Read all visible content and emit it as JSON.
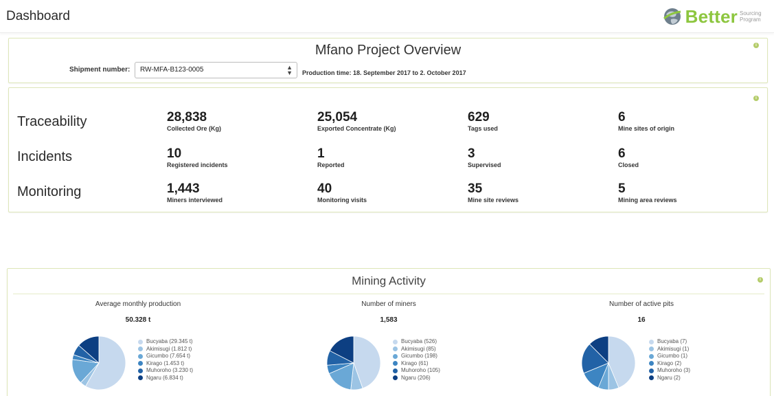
{
  "header": {
    "title": "Dashboard",
    "logo_word": "Better",
    "logo_sub": "Sourcing Program"
  },
  "overview": {
    "title": "Mfano Project Overview",
    "shipment_label": "Shipment number:",
    "shipment_value": "RW-MFA-B123-0005",
    "production_time": "Production time: 18. September 2017 to 2. October 2017"
  },
  "stats": {
    "rows": [
      {
        "label": "Traceability",
        "items": [
          {
            "value": "28,838",
            "label": "Collected Ore (Kg)"
          },
          {
            "value": "25,054",
            "label": "Exported Concentrate (Kg)"
          },
          {
            "value": "629",
            "label": "Tags used"
          },
          {
            "value": "6",
            "label": "Mine sites of origin"
          }
        ]
      },
      {
        "label": "Incidents",
        "items": [
          {
            "value": "10",
            "label": "Registered incidents"
          },
          {
            "value": "1",
            "label": "Reported"
          },
          {
            "value": "3",
            "label": "Supervised"
          },
          {
            "value": "6",
            "label": "Closed"
          }
        ]
      },
      {
        "label": "Monitoring",
        "items": [
          {
            "value": "1,443",
            "label": "Miners interviewed"
          },
          {
            "value": "40",
            "label": "Monitoring visits"
          },
          {
            "value": "35",
            "label": "Mine site reviews"
          },
          {
            "value": "5",
            "label": "Mining area reviews"
          }
        ]
      }
    ]
  },
  "mining": {
    "title": "Mining Activity",
    "palette": [
      "#c6d9ee",
      "#9cc4e4",
      "#6aa8d6",
      "#3d85c2",
      "#2262a6",
      "#0d3f82"
    ],
    "charts": [
      {
        "title": "Average monthly production",
        "total": "50.328 t",
        "legend": [
          "Bucyaba (29.345 t)",
          "Akimisugi (1.812 t)",
          "Gicumbo (7.654 t)",
          "Kirago (1.453 t)",
          "Muhoroho (3.230 t)",
          "Ngaru (6.834 t)"
        ]
      },
      {
        "title": "Number of miners",
        "total": "1,583",
        "legend": [
          "Bucyaba (526)",
          "Akimisugi (85)",
          "Gicumbo (198)",
          "Kirago (61)",
          "Muhoroho (105)",
          "Ngaru (206)"
        ]
      },
      {
        "title": "Number of active pits",
        "total": "16",
        "legend": [
          "Bucyaba (7)",
          "Akimisugi (1)",
          "Gicumbo (1)",
          "Kirago (2)",
          "Muhoroho (3)",
          "Ngaru (2)"
        ]
      }
    ]
  },
  "chart_data": [
    {
      "type": "pie",
      "categories": [
        "Bucyaba",
        "Akimisugi",
        "Gicumbo",
        "Kirago",
        "Muhoroho",
        "Ngaru"
      ],
      "values": [
        29.345,
        1.812,
        7.654,
        1.453,
        3.23,
        6.834
      ]
    },
    {
      "type": "pie",
      "categories": [
        "Bucyaba",
        "Akimisugi",
        "Gicumbo",
        "Kirago",
        "Muhoroho",
        "Ngaru"
      ],
      "values": [
        526,
        85,
        198,
        61,
        105,
        206
      ]
    },
    {
      "type": "pie",
      "categories": [
        "Bucyaba",
        "Akimisugi",
        "Gicumbo",
        "Kirago",
        "Muhoroho",
        "Ngaru"
      ],
      "values": [
        7,
        1,
        1,
        2,
        3,
        2
      ]
    }
  ]
}
